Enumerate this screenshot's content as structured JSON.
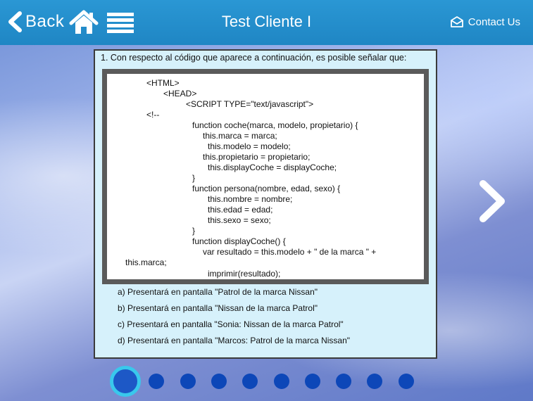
{
  "header": {
    "back_label": "Back",
    "title": "Test Cliente I",
    "contact_label": "Contact Us"
  },
  "question": {
    "text": "1. Con respecto al código que aparece a continuación, es posible señalar que:",
    "code_lines": [
      "<HTML>",
      "<HEAD>",
      "<SCRIPT TYPE=\"text/javascript\">",
      "<!--",
      "function coche(marca, modelo, propietario) {",
      "this.marca = marca;",
      "this.modelo = modelo;",
      "this.propietario = propietario;",
      "this.displayCoche = displayCoche;",
      "}",
      "function persona(nombre, edad, sexo) {",
      "this.nombre = nombre;",
      "this.edad = edad;",
      "this.sexo = sexo;",
      "}",
      "function displayCoche() {",
      "var resultado = this.modelo + \" de la marca \" +",
      "this.marca;",
      "imprimir(resultado);"
    ],
    "answers": [
      "a)  Presentará en pantalla \"Patrol de la marca Nissan\"",
      "b)  Presentará en pantalla \"Nissan de la marca Patrol\"",
      "c)  Presentará en pantalla \"Sonia: Nissan de la marca Patrol\"",
      "d)  Presentará en pantalla \"Marcos: Patrol de la marca Nissan\""
    ]
  },
  "pagination": {
    "total_pages": 10,
    "current_page": 1
  },
  "icons": {
    "back": "chevron-left-icon",
    "home": "home-icon",
    "menu": "hamburger-menu-icon",
    "contact": "envelope-icon",
    "next": "chevron-right-icon"
  },
  "colors": {
    "header_bg": "#2a97d4",
    "panel_bg": "#d6f1fb",
    "dot": "#0d47b8",
    "dot_active_ring": "#39c8ec"
  }
}
